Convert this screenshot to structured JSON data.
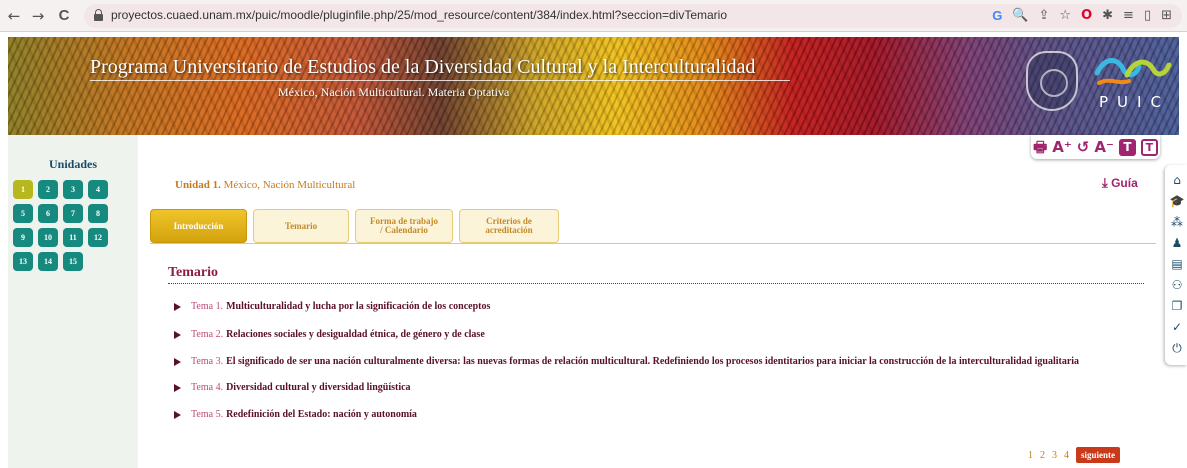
{
  "browser": {
    "url": "proyectos.cuaed.unam.mx/puic/moodle/pluginfile.php/25/mod_resource/content/384/index.html?seccion=divTemario",
    "back_icon": "←",
    "forward_icon": "→",
    "reload_icon": "C",
    "toolbar_icons": [
      "G",
      "🔍",
      "⇪",
      "☆",
      "O",
      "✱",
      "≡",
      "▯",
      "⊞"
    ]
  },
  "banner": {
    "title": "Programa Universitario de Estudios de la Diversidad Cultural y la Interculturalidad",
    "subtitle": "México, Nación Multicultural. Materia Optativa",
    "logo_text": "PUIC"
  },
  "sidebar": {
    "title": "Unidades",
    "units": [
      "1",
      "2",
      "3",
      "4",
      "5",
      "6",
      "7",
      "8",
      "9",
      "10",
      "11",
      "12",
      "13",
      "14",
      "15"
    ],
    "active_unit": "1"
  },
  "accessibility": {
    "print_icon": "🖶",
    "increase_font": "A⁺",
    "reset_icon": "↺",
    "decrease_font": "A⁻",
    "contrast_dark": "T",
    "contrast_light": "T"
  },
  "unit": {
    "label": "Unidad 1.",
    "name": "México, Nación Multicultural",
    "guide_label": "Guía",
    "download_icon": "⤓"
  },
  "tabs": [
    {
      "label": "Introducción"
    },
    {
      "label": "Temario"
    },
    {
      "label": "Forma de trabajo / Calendario"
    },
    {
      "label": "Criterios de acreditación"
    }
  ],
  "section": {
    "title": "Temario"
  },
  "topics": [
    {
      "num": "Tema 1.",
      "text": "Multiculturalidad y lucha por la significación de los conceptos"
    },
    {
      "num": "Tema 2.",
      "text": "Relaciones sociales y desigualdad étnica, de género y de clase"
    },
    {
      "num": "Tema 3.",
      "text": "El significado de ser una nación culturalmente diversa: las nuevas formas de relación multicultural. Redefiniendo los procesos identitarios para iniciar la construcción de la interculturalidad igualitaria"
    },
    {
      "num": "Tema 4.",
      "text": "Diversidad cultural y diversidad lingüística"
    },
    {
      "num": "Tema 5.",
      "text": "Redefinición del Estado: nación y autonomía"
    }
  ],
  "pager": {
    "pages": [
      "1",
      "2",
      "3",
      "4"
    ],
    "next_label": "siguiente"
  },
  "right_toolbar": {
    "icons": [
      "home-icon",
      "graduation-cap-icon",
      "group-icon",
      "user-icon",
      "book-icon",
      "users-icon",
      "chat-icon",
      "check-icon",
      "power-icon"
    ],
    "glyphs": [
      "⌂",
      "🎓",
      "⁂",
      "♟",
      "▤",
      "⚇",
      "❐",
      "✓",
      "⏻"
    ]
  }
}
